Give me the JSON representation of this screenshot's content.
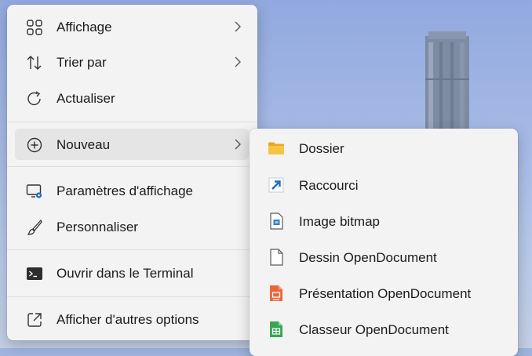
{
  "context_menu": {
    "items": [
      {
        "label": "Affichage",
        "icon": "grid-icon",
        "has_submenu": true
      },
      {
        "label": "Trier par",
        "icon": "sort-icon",
        "has_submenu": true
      },
      {
        "label": "Actualiser",
        "icon": "refresh-icon",
        "has_submenu": false
      },
      {
        "label": "Nouveau",
        "icon": "add-circle-icon",
        "has_submenu": true,
        "highlighted": true
      },
      {
        "label": "Paramètres d'affichage",
        "icon": "display-settings-icon",
        "has_submenu": false
      },
      {
        "label": "Personnaliser",
        "icon": "brush-icon",
        "has_submenu": false
      },
      {
        "label": "Ouvrir dans le Terminal",
        "icon": "terminal-icon",
        "has_submenu": false
      },
      {
        "label": "Afficher d'autres options",
        "icon": "open-external-icon",
        "has_submenu": false
      }
    ]
  },
  "new_submenu": {
    "items": [
      {
        "label": "Dossier",
        "icon": "folder-icon"
      },
      {
        "label": "Raccourci",
        "icon": "shortcut-icon"
      },
      {
        "label": "Image bitmap",
        "icon": "bitmap-file-icon"
      },
      {
        "label": "Dessin OpenDocument",
        "icon": "blank-file-icon"
      },
      {
        "label": "Présentation OpenDocument",
        "icon": "presentation-file-icon"
      },
      {
        "label": "Classeur OpenDocument",
        "icon": "spreadsheet-file-icon"
      }
    ]
  },
  "colors": {
    "menu_bg": "#f3f3f3",
    "highlight": "#e5e5e5",
    "folder": "#f6c443",
    "shortcut": "#1f6fb8",
    "presentation": "#e8683a",
    "spreadsheet": "#3aa655"
  }
}
